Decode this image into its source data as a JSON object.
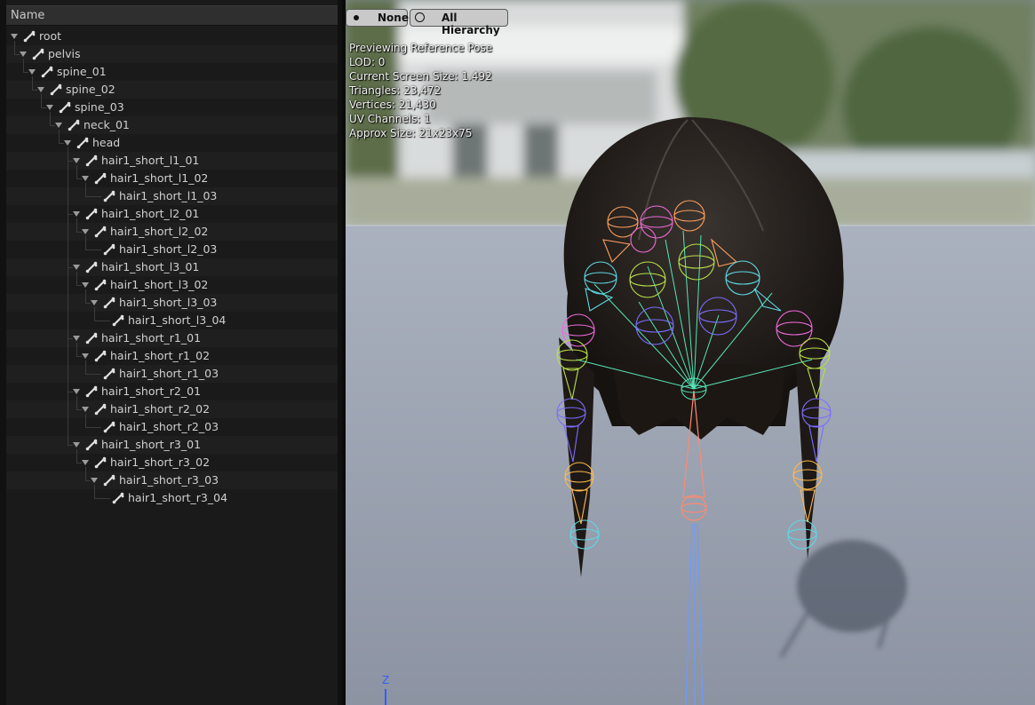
{
  "tree": {
    "header": "Name",
    "rows": [
      {
        "label": "root",
        "depth": 0,
        "expand": true
      },
      {
        "label": "pelvis",
        "depth": 1,
        "expand": true
      },
      {
        "label": "spine_01",
        "depth": 2,
        "expand": true
      },
      {
        "label": "spine_02",
        "depth": 3,
        "expand": true
      },
      {
        "label": "spine_03",
        "depth": 4,
        "expand": true
      },
      {
        "label": "neck_01",
        "depth": 5,
        "expand": true
      },
      {
        "label": "head",
        "depth": 6,
        "expand": true
      },
      {
        "label": "hair1_short_l1_01",
        "depth": 7,
        "expand": true
      },
      {
        "label": "hair1_short_l1_02",
        "depth": 8,
        "expand": true
      },
      {
        "label": "hair1_short_l1_03",
        "depth": 9,
        "expand": false
      },
      {
        "label": "hair1_short_l2_01",
        "depth": 7,
        "expand": true
      },
      {
        "label": "hair1_short_l2_02",
        "depth": 8,
        "expand": true
      },
      {
        "label": "hair1_short_l2_03",
        "depth": 9,
        "expand": false
      },
      {
        "label": "hair1_short_l3_01",
        "depth": 7,
        "expand": true
      },
      {
        "label": "hair1_short_l3_02",
        "depth": 8,
        "expand": true
      },
      {
        "label": "hair1_short_l3_03",
        "depth": 9,
        "expand": true
      },
      {
        "label": "hair1_short_l3_04",
        "depth": 10,
        "expand": false
      },
      {
        "label": "hair1_short_r1_01",
        "depth": 7,
        "expand": true
      },
      {
        "label": "hair1_short_r1_02",
        "depth": 8,
        "expand": true
      },
      {
        "label": "hair1_short_r1_03",
        "depth": 9,
        "expand": false
      },
      {
        "label": "hair1_short_r2_01",
        "depth": 7,
        "expand": true
      },
      {
        "label": "hair1_short_r2_02",
        "depth": 8,
        "expand": true
      },
      {
        "label": "hair1_short_r2_03",
        "depth": 9,
        "expand": false
      },
      {
        "label": "hair1_short_r3_01",
        "depth": 7,
        "expand": true
      },
      {
        "label": "hair1_short_r3_02",
        "depth": 8,
        "expand": true
      },
      {
        "label": "hair1_short_r3_03",
        "depth": 9,
        "expand": true
      },
      {
        "label": "hair1_short_r3_04",
        "depth": 10,
        "expand": false
      }
    ]
  },
  "viewport": {
    "buttons": {
      "none_label": "None",
      "hierarchy_label": "All Hierarchy"
    },
    "stats": {
      "mode": "Previewing Reference Pose",
      "lod": "LOD: 0",
      "screen_size": "Current Screen Size: 1.492",
      "triangles": "Triangles: 23,472",
      "vertices": "Vertices: 21,430",
      "uv_channels": "UV Channels: 1",
      "approx_size": "Approx Size: 21x23x75"
    },
    "axis_label": "Z"
  }
}
